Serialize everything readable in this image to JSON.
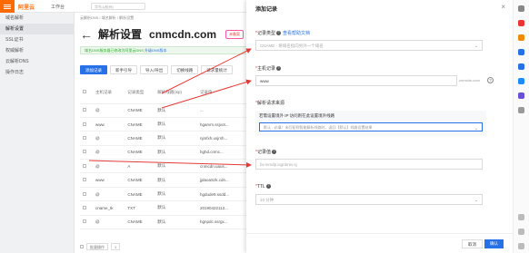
{
  "topbar": {
    "brand": "阿里云",
    "nav": "工作台",
    "search_placeholder": "华东1(杭州)"
  },
  "sidebar": {
    "items": [
      {
        "label": "域名解析",
        "active": false
      },
      {
        "label": "解析设置",
        "active": true
      },
      {
        "label": "SSL证书",
        "active": false
      },
      {
        "label": "权威解析",
        "active": false
      },
      {
        "label": "云解析DNS",
        "active": false
      },
      {
        "label": "操作日志",
        "active": false
      }
    ]
  },
  "main": {
    "breadcrumb": "云解析DNS / 域名解析 / 解析设置",
    "title": "解析设置",
    "domain": "cnmcdn.com",
    "tag": "未备案",
    "notice": "域名DNS服务器已修改为阿里云DNS",
    "notice_link": "升级DNS版本",
    "toolbar": [
      "添加记录",
      "新手引导",
      "导入/导出",
      "切换线路",
      "请求量统计"
    ],
    "table_headers": [
      "主机记录",
      "记录类型",
      "解析线路(isp)",
      "记录值"
    ],
    "rows": [
      {
        "host": "@",
        "type": "CNAME",
        "line": "默认",
        "value": "..."
      },
      {
        "host": "www",
        "type": "CNAME",
        "line": "默认",
        "value": "hgarvm.ssjvot..."
      },
      {
        "host": "@",
        "type": "CNAME",
        "line": "默认",
        "value": "njmfxh.usjrsh..."
      },
      {
        "host": "@",
        "type": "CNAME",
        "line": "默认",
        "value": "hghd.cnmc..."
      },
      {
        "host": "@",
        "type": "A",
        "line": "默认",
        "value": "cnmcdn.uaus..."
      },
      {
        "host": "www",
        "type": "CNAME",
        "line": "默认",
        "value": "jjdaoaSzk.cdn..."
      },
      {
        "host": "@",
        "type": "CNAME",
        "line": "默认",
        "value": "hgdude9.ssdd..."
      },
      {
        "host": "cname_tk",
        "type": "TXT",
        "line": "默认",
        "value": "20190422112..."
      },
      {
        "host": "@",
        "type": "CNAME",
        "line": "默认",
        "value": "hgnpdc.ssrgx..."
      }
    ],
    "pager": [
      "批量操作",
      "1"
    ]
  },
  "panel": {
    "title": "添加记录",
    "record_type_label": "记录类型",
    "record_type_link": "查看帮助文档",
    "record_type_value": "CNAME - 将域名指向另外一个域名",
    "host_label": "主机记录",
    "host_value": "www",
    "host_suffix": ".cnmcdn.com",
    "line_label": "解析请求来源",
    "line_note": "若需设置境外 IP 访问则在此设置境外线路",
    "line_value": "默认 - 必填！未匹配到智能解析线路时，返回【默认】线路设置结果",
    "value_label": "记录值",
    "value_placeholder": "bv.mmdp.isgnbrev.sj",
    "ttl_label": "TTL",
    "ttl_value": "10 分钟",
    "cancel": "取消",
    "ok": "确认"
  },
  "colors": {
    "accent": "#2670e8",
    "brand": "#ff6a00",
    "arrow": "#e53935"
  }
}
